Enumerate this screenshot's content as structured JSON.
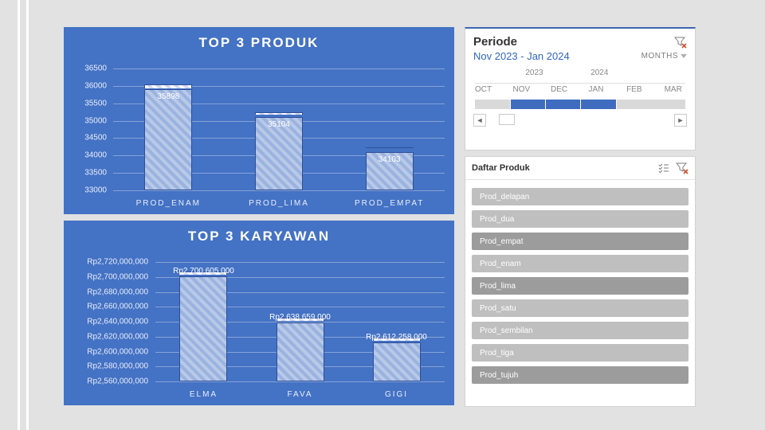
{
  "chart1": {
    "title": "TOP 3 PRODUK",
    "y_ticks": [
      33000,
      33500,
      34000,
      34500,
      35000,
      35500,
      36000,
      36500
    ],
    "ylim": [
      33000,
      36500
    ],
    "categories": [
      "PROD_ENAM",
      "PROD_LIMA",
      "PROD_EMPAT"
    ],
    "values": [
      35898,
      35104,
      34103
    ],
    "cap_values": [
      36050,
      35200,
      34150
    ]
  },
  "chart2": {
    "title": "TOP 3 KARYAWAN",
    "y_ticks_raw": [
      2560000000,
      2580000000,
      2600000000,
      2620000000,
      2640000000,
      2660000000,
      2680000000,
      2700000000,
      2720000000
    ],
    "y_ticks": [
      "Rp2,560,000,000",
      "Rp2,580,000,000",
      "Rp2,600,000,000",
      "Rp2,620,000,000",
      "Rp2,640,000,000",
      "Rp2,660,000,000",
      "Rp2,680,000,000",
      "Rp2,700,000,000",
      "Rp2,720,000,000"
    ],
    "ylim": [
      2560000000,
      2720000000
    ],
    "categories": [
      "ELMA",
      "FAVA",
      "GIGI"
    ],
    "values": [
      2700605000,
      2638659000,
      2612258000
    ],
    "value_labels": [
      "Rp2,700,605,000",
      "Rp2,638,659,000",
      "Rp2,612,258,000"
    ],
    "cap_values": [
      2707000000,
      2644000000,
      2619000000
    ]
  },
  "periode": {
    "title": "Periode",
    "range": "Nov 2023 - Jan 2024",
    "granularity": "MONTHS",
    "years": [
      {
        "label": "2023",
        "pos": 0.24
      },
      {
        "label": "2024",
        "pos": 0.55
      }
    ],
    "months": [
      {
        "label": "OCT",
        "pos": 0.0,
        "selected": false,
        "partial": true
      },
      {
        "label": "NOV",
        "pos": 0.18,
        "selected": true
      },
      {
        "label": "DEC",
        "pos": 0.36,
        "selected": true
      },
      {
        "label": "JAN",
        "pos": 0.54,
        "selected": true
      },
      {
        "label": "FEB",
        "pos": 0.72,
        "selected": false
      },
      {
        "label": "MAR",
        "pos": 0.9,
        "selected": false,
        "partial": true
      }
    ]
  },
  "daftar": {
    "title": "Daftar Produk",
    "items": [
      {
        "label": "Prod_delapan",
        "selected": false
      },
      {
        "label": "Prod_dua",
        "selected": false
      },
      {
        "label": "Prod_empat",
        "selected": true
      },
      {
        "label": "Prod_enam",
        "selected": false
      },
      {
        "label": "Prod_lima",
        "selected": true
      },
      {
        "label": "Prod_satu",
        "selected": false
      },
      {
        "label": "Prod_sembilan",
        "selected": false
      },
      {
        "label": "Prod_tiga",
        "selected": false
      },
      {
        "label": "Prod_tujuh",
        "selected": true
      }
    ]
  },
  "chart_data": [
    {
      "type": "bar",
      "title": "TOP 3 PRODUK",
      "categories": [
        "PROD_ENAM",
        "PROD_LIMA",
        "PROD_EMPAT"
      ],
      "values": [
        35898,
        35104,
        34103
      ],
      "ylim": [
        33000,
        36500
      ],
      "ylabel": "",
      "xlabel": ""
    },
    {
      "type": "bar",
      "title": "TOP 3 KARYAWAN",
      "categories": [
        "ELMA",
        "FAVA",
        "GIGI"
      ],
      "values": [
        2700605000,
        2638659000,
        2612258000
      ],
      "ylim": [
        2560000000,
        2720000000
      ],
      "ylabel": "Rp",
      "xlabel": ""
    }
  ]
}
